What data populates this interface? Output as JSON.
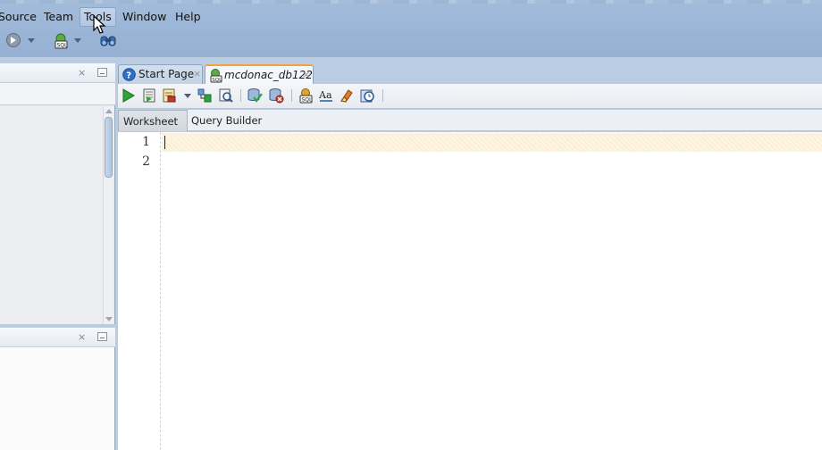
{
  "menubar": {
    "items": [
      {
        "label": "Source"
      },
      {
        "label": "Team"
      },
      {
        "label": "Tools"
      },
      {
        "label": "Window"
      },
      {
        "label": "Help"
      }
    ],
    "active_item": "Tools"
  },
  "main_toolbar": {
    "icons": [
      "forward-nav-icon",
      "sql-worksheet-icon",
      "search-binoculars-icon"
    ]
  },
  "left_panels": {
    "top": {
      "close_glyph": "×"
    },
    "bottom": {
      "close_glyph": "×"
    }
  },
  "document_tabs": [
    {
      "label": "Start Page",
      "icon": "help-icon",
      "close_glyph": "×",
      "active": false
    },
    {
      "label": "mcdonac_db122",
      "icon": "sql-connection-icon",
      "close_glyph": "×",
      "active": true
    }
  ],
  "editor_toolbar": {
    "icons": [
      "run-statement-icon",
      "run-script-icon",
      "autotrace-icon",
      "explain-plan-icon",
      "sql-tuning-icon",
      "commit-icon",
      "rollback-icon",
      "unshared-sql-icon",
      "format-case-icon",
      "clear-icon",
      "history-icon"
    ]
  },
  "sub_tabs": [
    {
      "label": "Worksheet",
      "selected": true
    },
    {
      "label": "Query Builder",
      "selected": false
    }
  ],
  "editor": {
    "line_numbers": [
      "1",
      "2"
    ]
  },
  "colors": {
    "frame": "#9ab5d6",
    "active_tab_accent": "#f2a33c",
    "current_line": "#fdf6e3"
  }
}
